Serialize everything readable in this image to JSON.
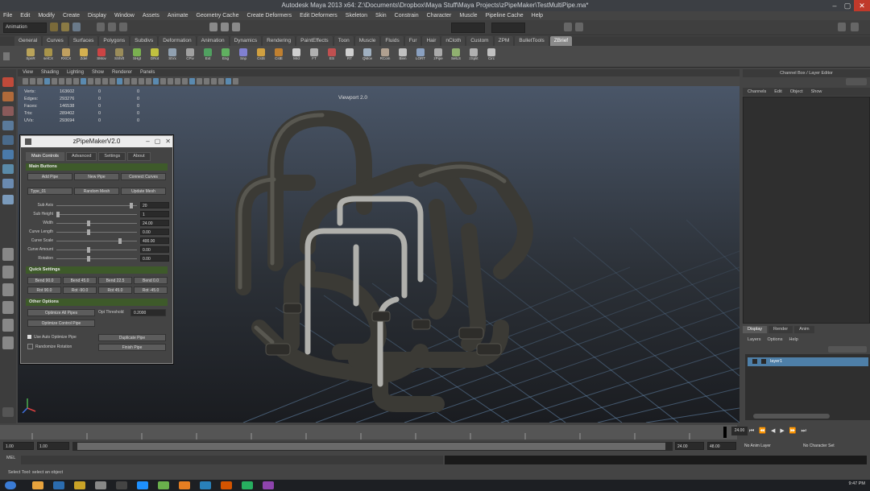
{
  "window": {
    "title": "Autodesk Maya 2013 x64: Z:\\Documents\\Dropbox\\Maya Stuff\\Maya Projects\\zPipeMaker\\TestMultiPipe.ma*",
    "controls": [
      "–",
      "▢",
      "✕"
    ]
  },
  "menubar": [
    "File",
    "Edit",
    "Modify",
    "Create",
    "Display",
    "Window",
    "Assets",
    "Animate",
    "Geometry Cache",
    "Create Deformers",
    "Edit Deformers",
    "Skeleton",
    "Skin",
    "Constrain",
    "Character",
    "Muscle",
    "Pipeline Cache",
    "Help"
  ],
  "statusline": {
    "mode": "Animation"
  },
  "shelf_tabs": [
    "General",
    "Curves",
    "Surfaces",
    "Polygons",
    "Subdivs",
    "Deformation",
    "Animation",
    "Dynamics",
    "Rendering",
    "PaintEffects",
    "Toon",
    "Muscle",
    "Fluids",
    "Fur",
    "Hair",
    "nCloth",
    "Custom",
    "ZPM",
    "BulletTools",
    "ZBrief"
  ],
  "shelf_active_tab": "ZBrief",
  "shelf_buttons": [
    "SpnR",
    "selCX",
    "RXCX",
    "Zdel",
    "SMov",
    "SShift",
    "SHgt",
    "DRot",
    "StVx",
    "CPiv",
    "Ext",
    "Eng",
    "Snp",
    "CstS",
    "CstE",
    "Mrd",
    "FT",
    "ES",
    "RT",
    "QMov",
    "RCom",
    "Blen",
    "LORT",
    "zPipe",
    "SelLS",
    "zSplit",
    "Circ"
  ],
  "viewport": {
    "menu": [
      "View",
      "Shading",
      "Lighting",
      "Show",
      "Renderer",
      "Panels"
    ],
    "label": "Viewport 2.0",
    "hud": [
      {
        "label": "Verts:",
        "values": [
          "163602",
          "0",
          "0"
        ]
      },
      {
        "label": "Edges:",
        "values": [
          "293276",
          "0",
          "0"
        ]
      },
      {
        "label": "Faces:",
        "values": [
          "146538",
          "0",
          "0"
        ]
      },
      {
        "label": "Tris:",
        "values": [
          "289402",
          "0",
          "0"
        ]
      },
      {
        "label": "UVs:",
        "values": [
          "293694",
          "0",
          "0"
        ]
      }
    ]
  },
  "pipe_dialog": {
    "title": "zPipeMakerV2.0",
    "tabs": [
      "Main Controls",
      "Advanced",
      "Settings",
      "About"
    ],
    "active_tab": "Main Controls",
    "sections": {
      "main": "Main Buttons",
      "quick": "Quick Settings",
      "other": "Other Options"
    },
    "main_buttons": [
      "Add Pipe",
      "New Pipe",
      "Connect Curves"
    ],
    "type_select": "Type_01",
    "randomize_label": "Random Mesh",
    "update_label": "Update Mesh",
    "sliders": [
      {
        "label": "Sub Axis",
        "value": "20",
        "level": 0.95
      },
      {
        "label": "Sub Height",
        "value": "1",
        "level": 0.0
      },
      {
        "label": "Width",
        "value": "24.00",
        "level": 0.4
      },
      {
        "label": "Curve Length",
        "value": "0.00",
        "level": 0.4
      },
      {
        "label": "Curve Scale",
        "value": "400.00",
        "level": 0.8
      },
      {
        "label": "Curve Amount",
        "value": "0.00",
        "level": 0.4
      },
      {
        "label": "Rotation",
        "value": "0.00",
        "level": 0.4
      }
    ],
    "quick_buttons": [
      "Bend 90.0",
      "Bend 45.0",
      "Bend 22.5",
      "Bend 0.0",
      "Rot 90.0",
      "Rot -90.0",
      "Rot 45.0",
      "Rot -45.0"
    ],
    "optimize_label": "Optimize All Pipes",
    "opt_threshold_label": "Opt Threshold",
    "opt_threshold_value": "0.2000",
    "optimize_curves_label": "Optimize Control Pipe",
    "checkbox1": "Use Auto Optimize Pipe",
    "checkbox2": "Randomize Rotation",
    "duplicate_label": "Duplicate Pipe",
    "finish_label": "Finish Pipe"
  },
  "channelbox": {
    "title": "Channel Box / Layer Editor",
    "menu": [
      "Channels",
      "Edit",
      "Object",
      "Show"
    ]
  },
  "layer_editor": {
    "tabs": [
      "Display",
      "Render",
      "Anim"
    ],
    "active_tab": "Display",
    "menu": [
      "Layers",
      "Options",
      "Help"
    ],
    "layer": "layer1"
  },
  "time": {
    "current": "24.00",
    "range_start": "1.00",
    "range_inner_start": "1.00",
    "range_end": "24.00",
    "range_inner_end": "48.00",
    "anim_layer": "No Anim Layer",
    "char_set": "No Character Set"
  },
  "cmdline_label": "MEL",
  "help_line": "Select Tool: select an object",
  "clock": "9:47 PM",
  "colors": {
    "accent_green": "#3e5a2a",
    "layer_blue": "#4e7fa8",
    "close_red": "#c0392b"
  },
  "icons": [
    "select-arrow-icon",
    "lasso-icon",
    "paint-icon",
    "move-icon",
    "rotate-icon",
    "scale-icon",
    "play-icon",
    "windows-start-icon"
  ]
}
